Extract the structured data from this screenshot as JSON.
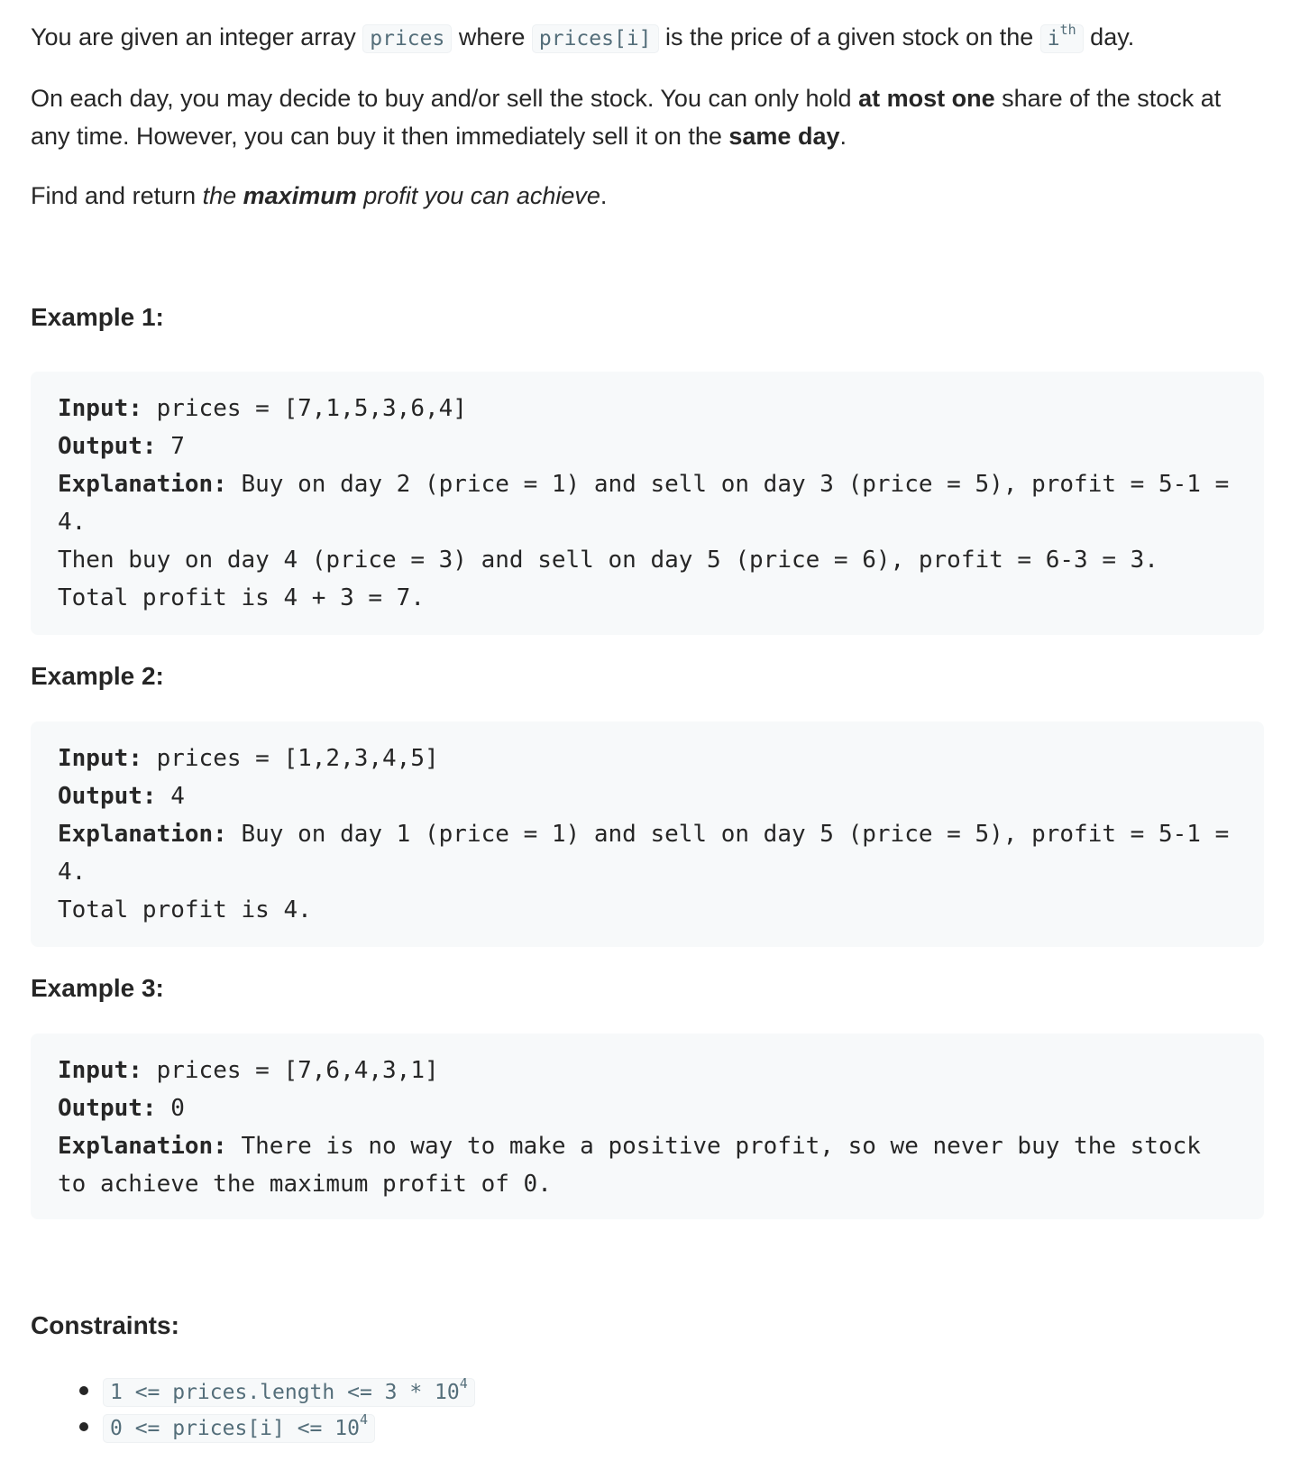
{
  "description": {
    "p1": {
      "t1": "You are given an integer array ",
      "c1": "prices",
      "t2": " where ",
      "c2": "prices[i]",
      "t3": " is the price of a given stock on the ",
      "c3": "i",
      "c3_sup": "th",
      "t4": " day."
    },
    "p2": {
      "t1": "On each day, you may decide to buy and/or sell the stock. You can only hold ",
      "b1": "at most one",
      "t2": " share of the stock at any time. However, you can buy it then immediately sell it on the ",
      "b2": "same day",
      "t3": "."
    },
    "p3": {
      "t1": "Find and return ",
      "i1": "the ",
      "b1": "maximum",
      "i2": " profit you can achieve",
      "t2": "."
    }
  },
  "examples": [
    {
      "title": "Example 1:",
      "input_label": "Input:",
      "input_value": " prices = [7,1,5,3,6,4]",
      "output_label": "Output:",
      "output_value": " 7",
      "explanation_label": "Explanation:",
      "explanation_value": " Buy on day 2 (price = 1) and sell on day 3 (price = 5), profit = 5-1 =",
      "lines": [
        "4.",
        "Then buy on day 4 (price = 3) and sell on day 5 (price = 6), profit = 6-3 = 3.",
        "Total profit is 4 + 3 = 7."
      ]
    },
    {
      "title": "Example 2:",
      "input_label": "Input:",
      "input_value": " prices = [1,2,3,4,5]",
      "output_label": "Output:",
      "output_value": " 4",
      "explanation_label": "Explanation:",
      "explanation_value": " Buy on day 1 (price = 1) and sell on day 5 (price = 5), profit = 5-1 =",
      "lines": [
        "4.",
        "Total profit is 4."
      ]
    },
    {
      "title": "Example 3:",
      "input_label": "Input:",
      "input_value": " prices = [7,6,4,3,1]",
      "output_label": "Output:",
      "output_value": " 0",
      "explanation_label": "Explanation:",
      "explanation_value": " There is no way to make a positive profit, so we never buy the stock",
      "lines": [
        "to achieve the maximum profit of 0."
      ]
    }
  ],
  "constraints": {
    "title": "Constraints:",
    "items": [
      {
        "text": "1 <= prices.length <= 3 * 10",
        "sup": "4"
      },
      {
        "text": "0 <= prices[i] <= 10",
        "sup": "4"
      }
    ]
  }
}
